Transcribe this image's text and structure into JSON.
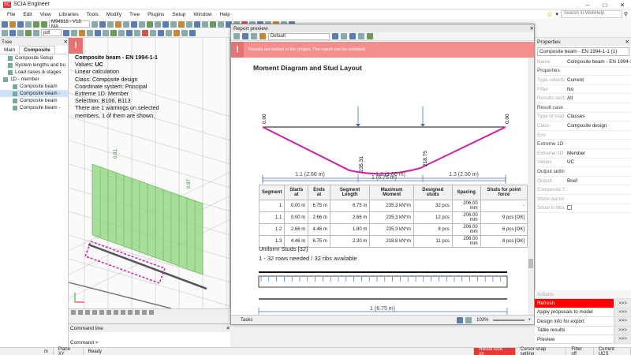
{
  "app": {
    "title": "SCIA Engineer",
    "logo": "SC"
  },
  "menu": [
    "File",
    "Edit",
    "View",
    "Libraries",
    "Tools",
    "Modify",
    "Tree",
    "Plugins",
    "Setup",
    "Window",
    "Help"
  ],
  "search_placeholder": "Search in WebHelp",
  "toolbar": {
    "combo_beam": "M94818 - V18 MA",
    "combo_pdf": "pdf"
  },
  "tree": {
    "header": "Tree",
    "tabs": [
      "Main",
      "Composite"
    ],
    "items": [
      {
        "label": "Composite Setup",
        "indent": 1
      },
      {
        "label": "System lengths and bu",
        "indent": 1
      },
      {
        "label": "Load cases & stages",
        "indent": 1
      },
      {
        "label": "1D - member",
        "indent": 0
      },
      {
        "label": "Composite beam",
        "indent": 2
      },
      {
        "label": "Composite beam -",
        "indent": 2,
        "selected": true
      },
      {
        "label": "Composite beam",
        "indent": 2
      },
      {
        "label": "Composite beam -",
        "indent": 2
      }
    ]
  },
  "viewport_info": {
    "title": "Composite beam - EN 1994-1-1",
    "values_label": "Values:",
    "values_value": "UC",
    "lines": [
      "Linear calculation",
      "Class: Composite design",
      "Coordinate system: Principal",
      "Extreme 1D: Member",
      "Selection: B106, B113",
      "There are 1 warnings on selected",
      "members. 1 of them are shown."
    ],
    "tag1": "0.91",
    "tag2": "0.97"
  },
  "command_line": {
    "header": "Command line",
    "prompt": "Command >"
  },
  "report": {
    "window_title": "Report preview",
    "style_combo": "Default",
    "alert_text": "Results are locked in the project. The report can be outdated.",
    "heading": "Moment Diagram and Stud Layout",
    "diagram": {
      "left_value": "0.00",
      "right_value": "0.00",
      "low1": "235.31",
      "low2": "218.75",
      "dim1": "1.1 (2.66 m)",
      "dim2": "1.2 (1.80 m)",
      "dim3": "1.3 (2.30 m)",
      "dim_total": "1 (6.75 m)"
    },
    "table": {
      "headers": [
        "Segment",
        "Starts at",
        "Ends at",
        "Segment Length",
        "Maximum Moment",
        "Designed studs",
        "Spacing",
        "Studs for point force"
      ],
      "rows": [
        [
          "1",
          "0.00 m",
          "6.75 m",
          "6.75 m",
          "235.3 kN*m",
          "32 pcs",
          "206.00 mm",
          "-"
        ],
        [
          "1.1",
          "0.00 m",
          "2.66 m",
          "2.66 m",
          "235.3 kN*m",
          "12 pcs",
          "206.00 mm",
          "9 pcs [OK]"
        ],
        [
          "1.2",
          "2.66 m",
          "4.46 m",
          "1.80 m",
          "235.3 kN*m",
          "8 pcs",
          "206.00 mm",
          "6 pcs [OK]"
        ],
        [
          "1.3",
          "4.46 m",
          "6.75 m",
          "2.30 m",
          "218.8 kN*m",
          "11 pcs",
          "206.00 mm",
          "8 pcs [OK]"
        ]
      ]
    },
    "uniform_heading": "Uniform Studs [32]",
    "uniform_rows": "1 - 32 rows needed / 32 ribs available",
    "stud_dim": "1 (6.75 m)",
    "tasks_label": "Tasks",
    "zoom": "103%"
  },
  "properties": {
    "header": "Properties",
    "combo": "Composite beam - EN 1994-1-1 (1)",
    "rows": [
      {
        "k": "Name",
        "v": "Composite beam - EN 1994-1-1 (1)"
      },
      {
        "k": "Properties",
        "v": "",
        "sec": true
      },
      {
        "k": "Type selection",
        "v": "Current"
      },
      {
        "k": "Filter",
        "v": "No"
      },
      {
        "k": "Results sections",
        "v": "All"
      },
      {
        "k": "Result case",
        "v": "",
        "sec": true
      },
      {
        "k": "Type of load",
        "v": "Classes"
      },
      {
        "k": "Class",
        "v": "Composite design"
      },
      {
        "k": "Env",
        "v": ""
      },
      {
        "k": "Extreme 1D",
        "v": "",
        "sec": true
      },
      {
        "k": "Extreme 1D",
        "v": "Member"
      },
      {
        "k": "Values",
        "v": "UC"
      },
      {
        "k": "Output settings",
        "v": "",
        "sec": true
      },
      {
        "k": "Output",
        "v": "Brief"
      },
      {
        "k": "Composite Setup...",
        "v": ""
      },
      {
        "k": "Show warnings...",
        "v": ""
      },
      {
        "k": "Show in Model D...",
        "v": "",
        "checkbox": true
      }
    ]
  },
  "actions": {
    "header": "Actions",
    "items": [
      {
        "label": "Refresh",
        "red": true
      },
      {
        "label": "Apply proposals to model"
      },
      {
        "label": "Design info for export"
      },
      {
        "label": "Table results"
      },
      {
        "label": "Preview"
      }
    ],
    "button_label": ">>>"
  },
  "statusbar": {
    "unit": "m",
    "plane": "Plane XY",
    "ready": "Ready",
    "result_lock": "Result lock: on",
    "cursor_snap": "Cursor snap setting",
    "filter": "Filter off",
    "ucs": "Current UCS"
  }
}
